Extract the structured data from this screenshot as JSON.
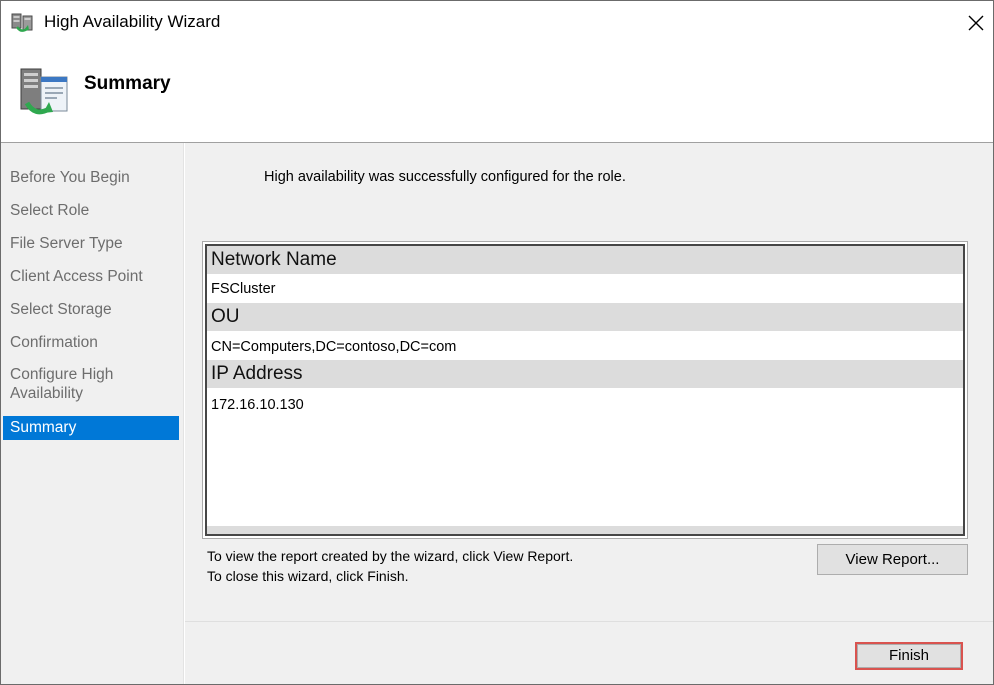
{
  "window": {
    "title": "High Availability Wizard",
    "icon": "cluster-wizard-icon"
  },
  "header": {
    "title": "Summary",
    "icon": "server-summary-icon"
  },
  "steps": [
    {
      "label": "Before You Begin",
      "active": false
    },
    {
      "label": "Select Role",
      "active": false
    },
    {
      "label": "File Server Type",
      "active": false
    },
    {
      "label": "Client Access Point",
      "active": false
    },
    {
      "label": "Select Storage",
      "active": false
    },
    {
      "label": "Confirmation",
      "active": false
    },
    {
      "label": "Configure High Availability",
      "active": false
    },
    {
      "label": "Summary",
      "active": true
    }
  ],
  "content": {
    "success_message": "High availability was successfully configured for the role.",
    "report": {
      "network_name_header": "Network Name",
      "network_name_value": "FSCluster",
      "ou_header": "OU",
      "ou_value": "CN=Computers,DC=contoso,DC=com",
      "ip_header": "IP Address",
      "ip_value": "172.16.10.130"
    },
    "hint_line1": "To view the report created by the wizard, click View Report.",
    "hint_line2": "To close this wizard, click Finish.",
    "view_report_label": "View Report...",
    "finish_label": "Finish"
  },
  "colors": {
    "active_step_bg": "#0078d7",
    "finish_highlight": "#d9534f"
  }
}
